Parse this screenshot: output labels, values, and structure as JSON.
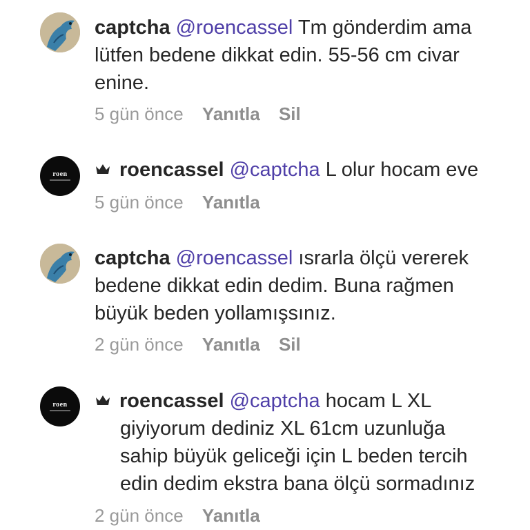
{
  "comments": [
    {
      "user": "captcha",
      "mention": "@roencassel",
      "lines_first": "Tm gönderdim ama",
      "lines": [
        "lütfen bedene dikkat edin. 55-56 cm civar",
        "enine."
      ],
      "time": "5 gün önce",
      "reply": "Yanıtla",
      "delete": "Sil"
    },
    {
      "user": "roencassel",
      "mention": "@captcha",
      "lines_first": "L olur hocam eve",
      "lines": [],
      "time": "5 gün önce",
      "reply": "Yanıtla",
      "avatar_text": "roen"
    },
    {
      "user": "captcha",
      "mention": "@roencassel",
      "lines_first": "ısrarla ölçü vererek",
      "lines": [
        "bedene dikkat edin dedim. Buna rağmen",
        "büyük beden yollamışsınız."
      ],
      "time": "2 gün önce",
      "reply": "Yanıtla",
      "delete": "Sil"
    },
    {
      "user": "roencassel",
      "mention": "@captcha",
      "lines_first": "hocam L XL",
      "lines": [
        "giyiyorum dediniz XL 61cm uzunluğa",
        "sahip büyük geliceği için L beden tercih",
        "edin dedim ekstra bana ölçü sormadınız"
      ],
      "time": "2 gün önce",
      "reply": "Yanıtla",
      "avatar_text": "roen"
    }
  ]
}
